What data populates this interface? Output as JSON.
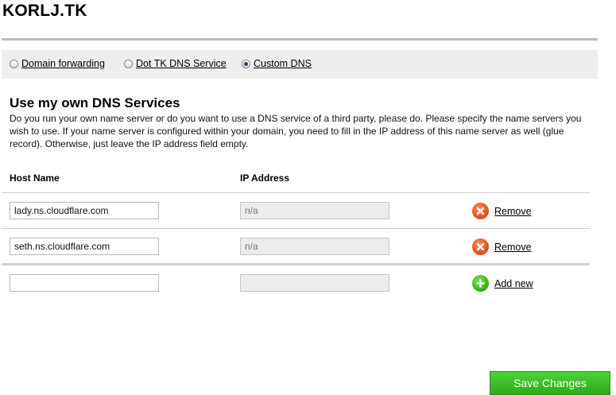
{
  "domain": {
    "title": "KORLJ.TK"
  },
  "mode_bar": {
    "options": [
      {
        "label": "Domain forwarding",
        "selected": false
      },
      {
        "label": "Dot TK DNS Service",
        "selected": false
      },
      {
        "label": "Custom DNS",
        "selected": true
      }
    ]
  },
  "dns_section": {
    "heading": "Use my own DNS Services",
    "description": "Do you run your own name server or do you want to use a DNS service of a third party, please do. Please specify the name servers you wish to use. If your name server is configured within your domain, you need to fill in the IP address of this name server as well (glue record). Otherwise, just leave the IP address field empty.",
    "columns": {
      "host": "Host Name",
      "ip": "IP Address"
    },
    "rows": [
      {
        "host": "lady.ns.cloudflare.com",
        "ip": "n/a",
        "action": "Remove"
      },
      {
        "host": "seth.ns.cloudflare.com",
        "ip": "n/a",
        "action": "Remove"
      }
    ],
    "new_row": {
      "host": "",
      "ip": "",
      "action": "Add new"
    }
  },
  "footer": {
    "save_label": "Save Changes"
  },
  "colors": {
    "remove": "#e2481b",
    "add": "#2fae12",
    "save": "#3cbb24"
  }
}
